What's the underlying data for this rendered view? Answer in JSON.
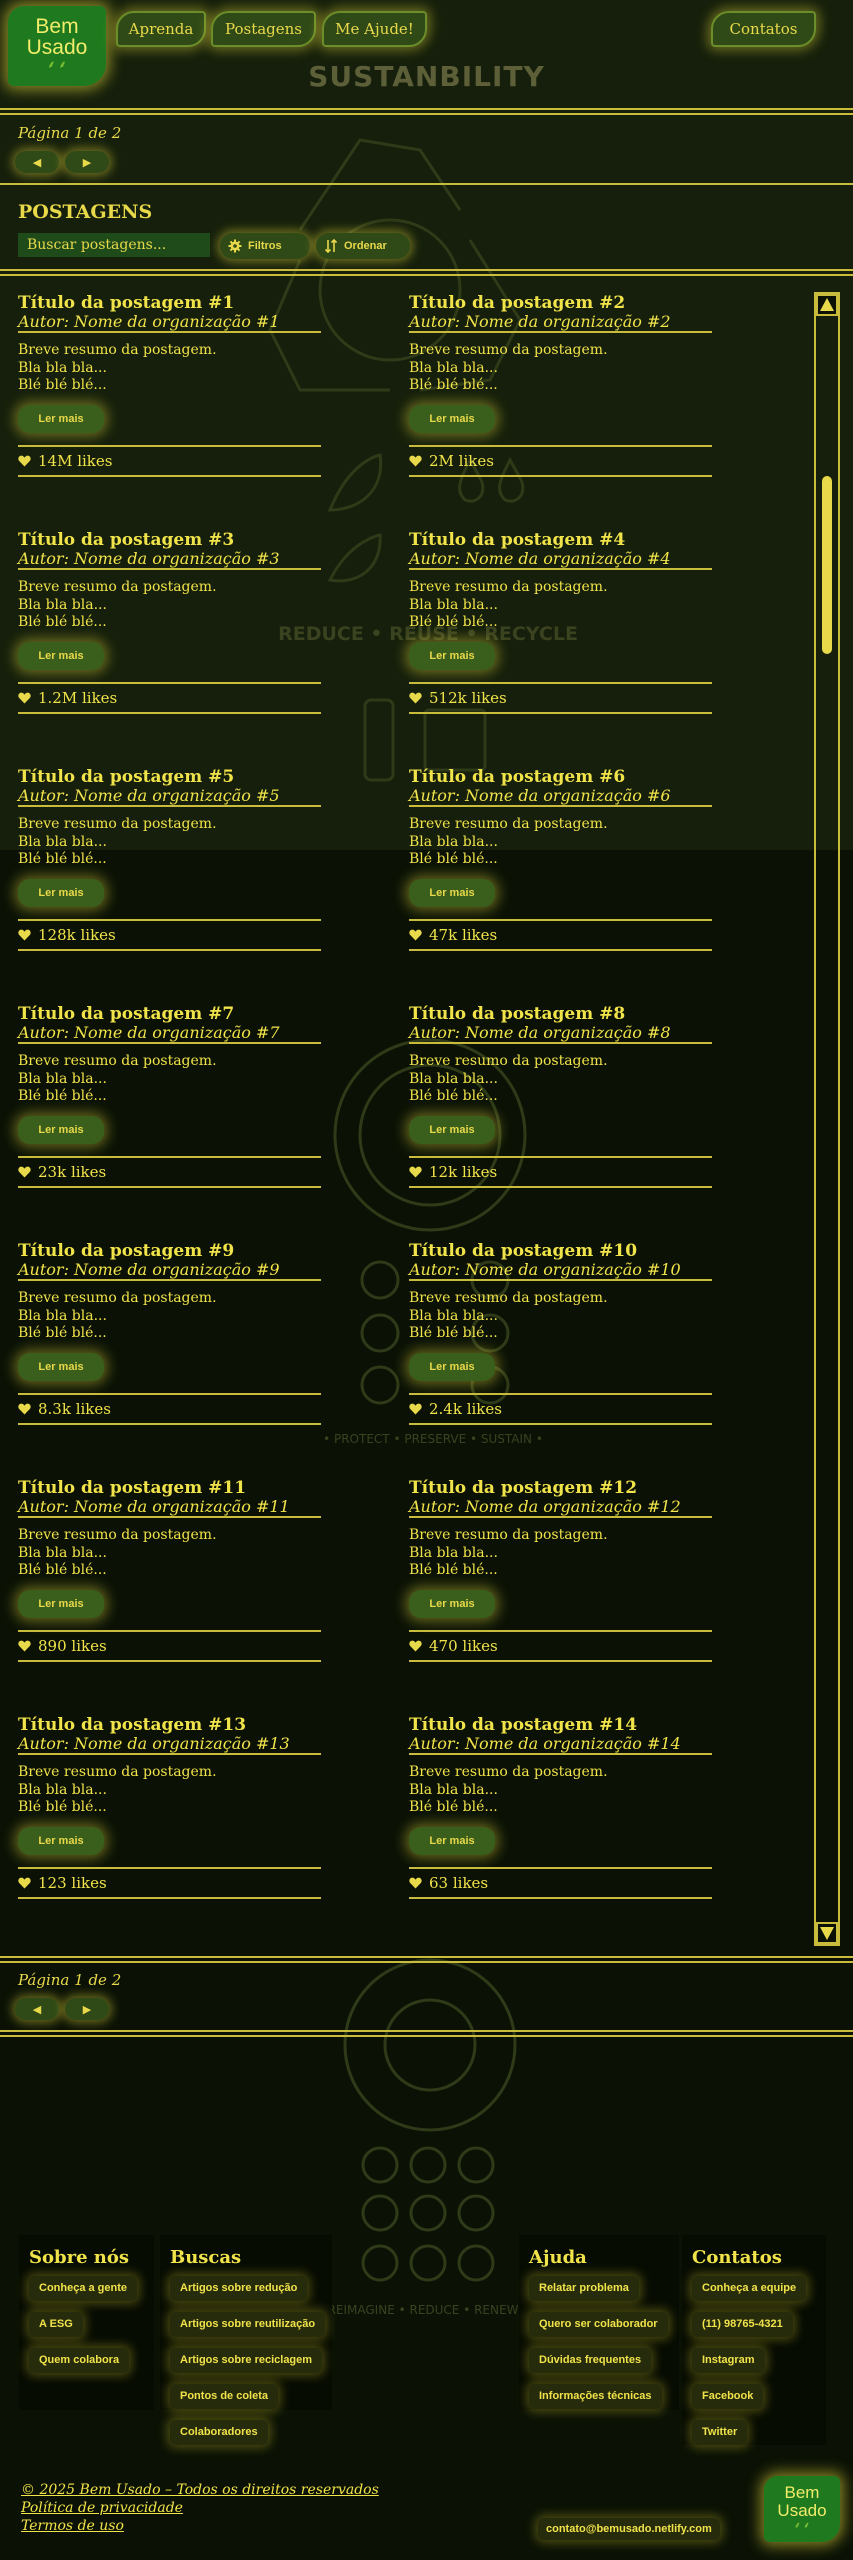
{
  "header": {
    "logo_line1": "Bem",
    "logo_line2": "Usado",
    "logo_leaves": "⸙ ⸙",
    "nav": {
      "aprenda": "Aprenda",
      "postagens": "Postagens",
      "ajuda": "Me Ajude!",
      "contatos": "Contatos"
    },
    "site_title": "SUSTANBILITY"
  },
  "pagination_top": {
    "label": "Página 1 de 2",
    "prev": "◀",
    "next": "▶"
  },
  "pagination_bottom": {
    "label": "Página 1 de 2",
    "prev": "◀",
    "next": "▶"
  },
  "posts_section": {
    "title": "POSTAGENS",
    "search_placeholder": "Buscar postagens...",
    "filters_label": "Filtros",
    "sort_label": "Ordenar",
    "filters_icon": "gear-icon",
    "sort_icon": "sort-icon"
  },
  "posts": [
    {
      "title": "Título da postagem #1",
      "author": "Autor: Nome da organização #1",
      "line1": "Breve resumo da postagem.",
      "line2": "Bla bla bla...",
      "line3": "Blé blé blé...",
      "button": "Ler mais",
      "likes": "14M likes"
    },
    {
      "title": "Título da postagem #2",
      "author": "Autor: Nome da organização #2",
      "line1": "Breve resumo da postagem.",
      "line2": "Bla bla bla...",
      "line3": "Blé blé blé...",
      "button": "Ler mais",
      "likes": "2M likes"
    },
    {
      "title": "Título da postagem #3",
      "author": "Autor: Nome da organização #3",
      "line1": "Breve resumo da postagem.",
      "line2": "Bla bla bla...",
      "line3": "Blé blé blé...",
      "button": "Ler mais",
      "likes": "1.2M likes"
    },
    {
      "title": "Título da postagem #4",
      "author": "Autor: Nome da organização #4",
      "line1": "Breve resumo da postagem.",
      "line2": "Bla bla bla...",
      "line3": "Blé blé blé...",
      "button": "Ler mais",
      "likes": "512k likes"
    },
    {
      "title": "Título da postagem #5",
      "author": "Autor: Nome da organização #5",
      "line1": "Breve resumo da postagem.",
      "line2": "Bla bla bla...",
      "line3": "Blé blé blé...",
      "button": "Ler mais",
      "likes": "128k likes"
    },
    {
      "title": "Título da postagem #6",
      "author": "Autor: Nome da organização #6",
      "line1": "Breve resumo da postagem.",
      "line2": "Bla bla bla...",
      "line3": "Blé blé blé...",
      "button": "Ler mais",
      "likes": "47k likes"
    },
    {
      "title": "Título da postagem #7",
      "author": "Autor: Nome da organização #7",
      "line1": "Breve resumo da postagem.",
      "line2": "Bla bla bla...",
      "line3": "Blé blé blé...",
      "button": "Ler mais",
      "likes": "23k likes"
    },
    {
      "title": "Título da postagem #8",
      "author": "Autor: Nome da organização #8",
      "line1": "Breve resumo da postagem.",
      "line2": "Bla bla bla...",
      "line3": "Blé blé blé...",
      "button": "Ler mais",
      "likes": "12k likes"
    },
    {
      "title": "Título da postagem #9",
      "author": "Autor: Nome da organização #9",
      "line1": "Breve resumo da postagem.",
      "line2": "Bla bla bla...",
      "line3": "Blé blé blé...",
      "button": "Ler mais",
      "likes": "8.3k likes"
    },
    {
      "title": "Título da postagem #10",
      "author": "Autor: Nome da organização #10",
      "line1": "Breve resumo da postagem.",
      "line2": "Bla bla bla...",
      "line3": "Blé blé blé...",
      "button": "Ler mais",
      "likes": "2.4k likes"
    },
    {
      "title": "Título da postagem #11",
      "author": "Autor: Nome da organização #11",
      "line1": "Breve resumo da postagem.",
      "line2": "Bla bla bla...",
      "line3": "Blé blé blé...",
      "button": "Ler mais",
      "likes": "890 likes"
    },
    {
      "title": "Título da postagem #12",
      "author": "Autor: Nome da organização #12",
      "line1": "Breve resumo da postagem.",
      "line2": "Bla bla bla...",
      "line3": "Blé blé blé...",
      "button": "Ler mais",
      "likes": "470 likes"
    },
    {
      "title": "Título da postagem #13",
      "author": "Autor: Nome da organização #13",
      "line1": "Breve resumo da postagem.",
      "line2": "Bla bla bla...",
      "line3": "Blé blé blé...",
      "button": "Ler mais",
      "likes": "123 likes"
    },
    {
      "title": "Título da postagem #14",
      "author": "Autor: Nome da organização #14",
      "line1": "Breve resumo da postagem.",
      "line2": "Bla bla bla...",
      "line3": "Blé blé blé...",
      "button": "Ler mais",
      "likes": "63 likes"
    }
  ],
  "scrollbar": {
    "up": "▲",
    "down": "▼"
  },
  "background_art": {
    "slogan1": "REDUCE • REUSE • RECYCLE",
    "slogan2": "• PROTECT • PRESERVE • SUSTAIN •",
    "slogan3": "REIMAGINE • REDUCE • RENEW"
  },
  "footer": {
    "sobre": {
      "title": "Sobre nós",
      "links": [
        "Conheça a gente",
        "A ESG",
        "Quem colabora"
      ]
    },
    "buscas": {
      "title": "Buscas",
      "links": [
        "Artigos sobre redução",
        "Artigos sobre reutilização",
        "Artigos sobre reciclagem",
        "Pontos de coleta",
        "Colaboradores"
      ]
    },
    "ajuda": {
      "title": "Ajuda",
      "links": [
        "Relatar problema",
        "Quero ser colaborador",
        "Dúvidas frequentes",
        "Informações técnicas"
      ]
    },
    "contatos": {
      "title": "Contatos",
      "links": [
        "Conheça a equipe",
        "(11) 98765-4321",
        "Instagram",
        "Facebook",
        "Twitter"
      ]
    },
    "copyright": "© 2025 Bem Usado – Todos os direitos reservados",
    "privacy": "Política de privacidade",
    "terms": "Termos de uso",
    "email": "contato@bemusado.netlify.com"
  },
  "colors": {
    "background": "#0b1205",
    "accent_yellow": "#e8d94a",
    "button_green": "#304a17",
    "logo_green": "#1f7a1f"
  }
}
